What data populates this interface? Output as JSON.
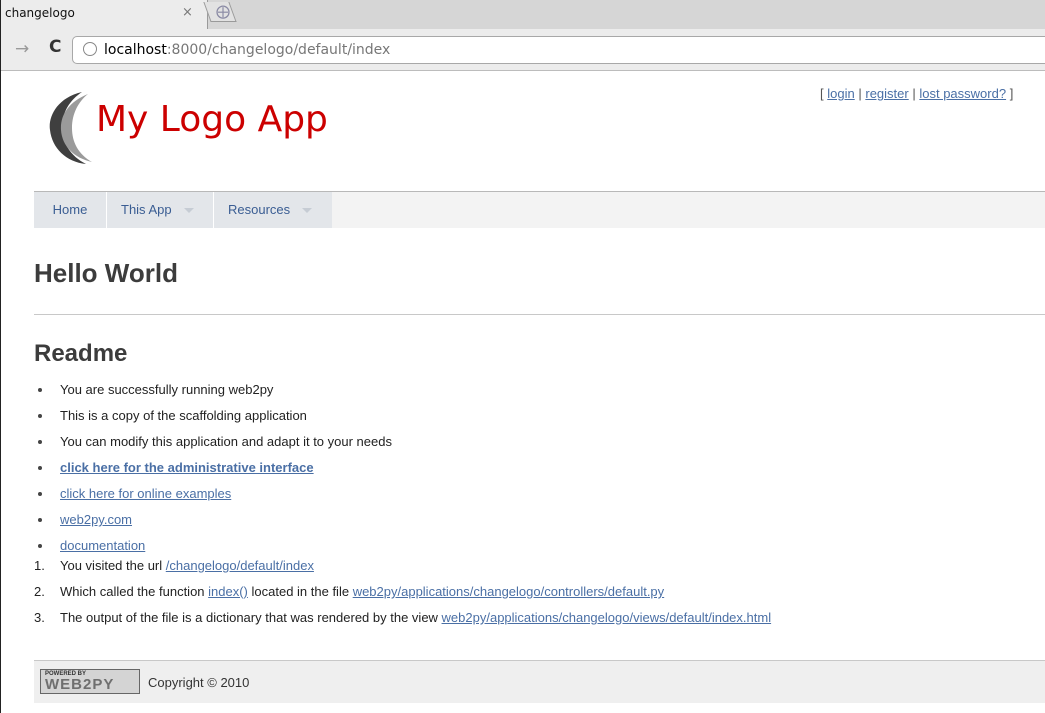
{
  "browser": {
    "tab_title": "changelogo",
    "tab_close": "×",
    "url_host": "localhost",
    "url_rest": ":8000/changelogo/default/index"
  },
  "header": {
    "logo_text": "My Logo App",
    "auth": {
      "open": "[",
      "login": "login",
      "register": "register",
      "lost_password": "lost password?",
      "sep": "|",
      "close": "]"
    }
  },
  "menu": [
    {
      "label": "Home"
    },
    {
      "label": "This App"
    },
    {
      "label": "Resources"
    }
  ],
  "main": {
    "title": "Hello World",
    "readme_title": "Readme",
    "bullets": [
      {
        "text": "You are successfully running web2py",
        "link": false,
        "bold": false
      },
      {
        "text": "This is a copy of the scaffolding application",
        "link": false,
        "bold": false
      },
      {
        "text": "You can modify this application and adapt it to your needs",
        "link": false,
        "bold": false
      },
      {
        "text": "click here for the administrative interface",
        "link": true,
        "bold": true
      },
      {
        "text": "click here for online examples",
        "link": true,
        "bold": false
      },
      {
        "text": "web2py.com",
        "link": true,
        "bold": false
      },
      {
        "text": "documentation",
        "link": true,
        "bold": false
      }
    ],
    "numbered": [
      {
        "num": "1.",
        "prefix": "You visited the url ",
        "link": "/changelogo/default/index"
      },
      {
        "num": "2.",
        "prefix": "Which called the function ",
        "link": "index()",
        "mid": " located in the file ",
        "link2": "web2py/applications/changelogo/controllers/default.py"
      },
      {
        "num": "3.",
        "prefix": "The output of the file is a dictionary that was rendered by the view ",
        "link": "web2py/applications/changelogo/views/default/index.html"
      }
    ]
  },
  "footer": {
    "badge_top": "POWERED BY",
    "badge_main": "WEB2PY",
    "copyright": "Copyright © 2010"
  }
}
